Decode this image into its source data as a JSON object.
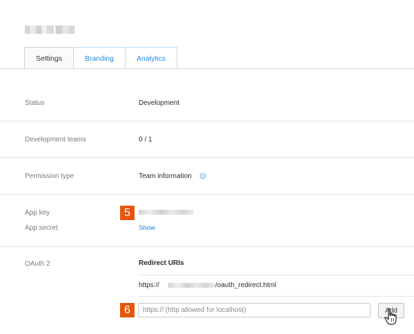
{
  "tabs": [
    "Settings",
    "Branding",
    "Analytics"
  ],
  "settings": {
    "status": {
      "label": "Status",
      "value": "Development"
    },
    "teams": {
      "label": "Development teams",
      "value": "0 / 1"
    },
    "permission": {
      "label": "Permission type",
      "value": "Team information"
    },
    "app_key": {
      "label": "App key"
    },
    "app_secret": {
      "label": "App secret",
      "link": "Show"
    },
    "oauth": {
      "label": "OAuth 2",
      "heading": "Redirect URIs",
      "uri_prefix": "https://",
      "uri_suffix": "/oauth_redirect.html",
      "input_placeholder": "https:// (http allowed for localhost)",
      "add_label": "Add"
    }
  },
  "badges": {
    "step5": "5",
    "step6": "6"
  },
  "colors": {
    "accent": "#1f8ceb",
    "badge": "#e4570f"
  },
  "icons": {
    "info": "info-icon",
    "cursor": "hand-cursor-icon"
  }
}
